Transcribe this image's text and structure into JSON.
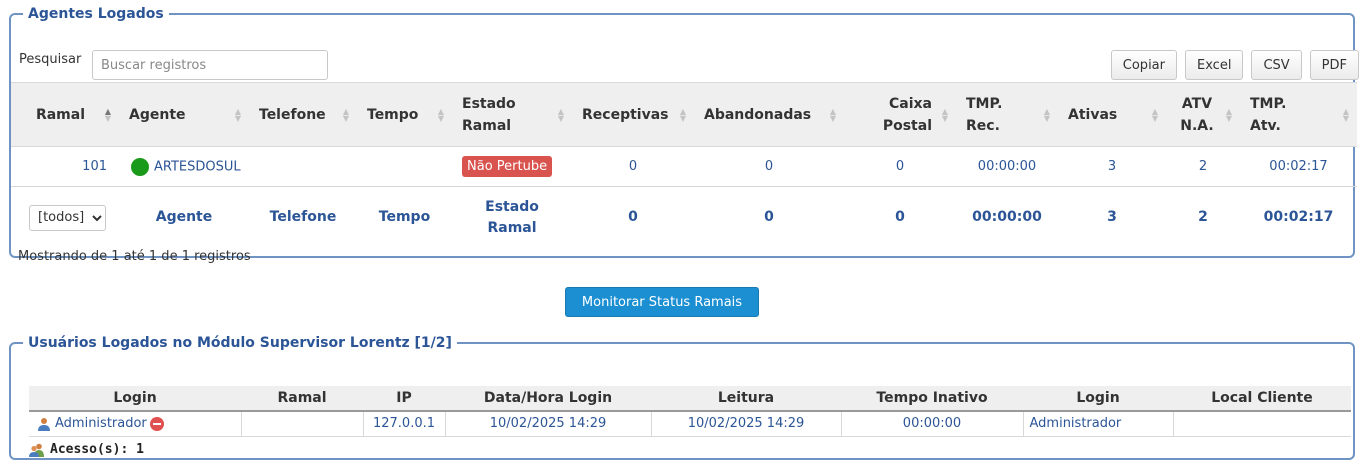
{
  "agents_panel": {
    "title": "Agentes Logados",
    "search": {
      "label": "Pesquisar",
      "placeholder": "Buscar registros",
      "value": ""
    },
    "export_buttons": [
      "Copiar",
      "Excel",
      "CSV",
      "PDF"
    ],
    "columns": [
      {
        "label": "Ramal",
        "sort": "asc"
      },
      {
        "label": "Agente",
        "sort": "none"
      },
      {
        "label": "Telefone",
        "sort": "none"
      },
      {
        "label": "Tempo",
        "sort": "none"
      },
      {
        "label": "Estado Ramal",
        "sort": "none"
      },
      {
        "label": "Receptivas",
        "sort": "none"
      },
      {
        "label": "Abandonadas",
        "sort": "none"
      },
      {
        "label": "Caixa Postal",
        "sort": "none"
      },
      {
        "label": "TMP. Rec.",
        "sort": "none"
      },
      {
        "label": "Ativas",
        "sort": "none"
      },
      {
        "label": "ATV N.A.",
        "sort": "none"
      },
      {
        "label": "TMP. Atv.",
        "sort": "none"
      }
    ],
    "rows": [
      {
        "ramal": "101",
        "agente": "ARTESDOSUL",
        "status_color": "#1a9a1a",
        "telefone": "",
        "tempo": "",
        "estado_ramal": "Não Pertube",
        "estado_color": "#d9534f",
        "receptivas": "0",
        "abandonadas": "0",
        "caixa_postal": "0",
        "tmp_rec": "00:00:00",
        "ativas": "3",
        "atv_na": "2",
        "tmp_atv": "00:02:17"
      }
    ],
    "footer": {
      "filter_select": "[todos]",
      "agente": "Agente",
      "telefone": "Telefone",
      "tempo": "Tempo",
      "estado_ramal": "Estado Ramal",
      "receptivas": "0",
      "abandonadas": "0",
      "caixa_postal": "0",
      "tmp_rec": "00:00:00",
      "ativas": "3",
      "atv_na": "2",
      "tmp_atv": "00:02:17"
    },
    "info": "Mostrando de 1 até 1 de 1 registros"
  },
  "monitor_button": "Monitorar Status Ramais",
  "users_panel": {
    "title": "Usuários Logados no Módulo Supervisor Lorentz [1/2]",
    "columns": [
      "Login",
      "Ramal",
      "IP",
      "Data/Hora Login",
      "Leitura",
      "Tempo Inativo",
      "Login",
      "Local Cliente"
    ],
    "rows": [
      {
        "login": "Administrador",
        "ramal": "",
        "ip": "127.0.0.1",
        "data_hora_login": "10/02/2025 14:29",
        "leitura": "10/02/2025 14:29",
        "tempo_inativo": "00:00:00",
        "login2": "Administrador",
        "local_cliente": ""
      }
    ],
    "access_text": "Acesso(s): 1"
  },
  "icons": [
    "sort-icon",
    "status-online-icon",
    "user-icon",
    "remove-icon",
    "users-group-icon",
    "chevron-down-icon"
  ],
  "colors": {
    "accent": "#2b5596",
    "border": "#6f93c2",
    "online": "#1a9a1a",
    "danger": "#d9534f",
    "primary_button": "#1b8fd1"
  }
}
